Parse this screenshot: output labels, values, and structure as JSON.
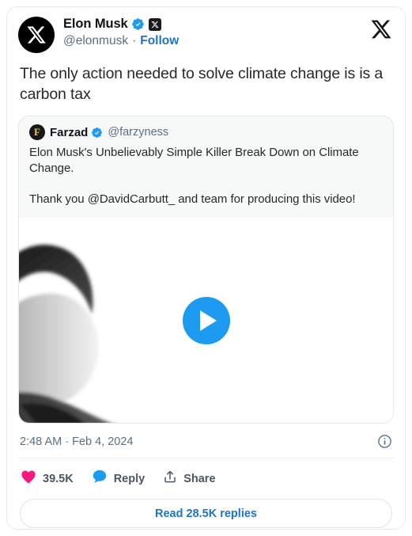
{
  "author": {
    "display_name": "Elon Musk",
    "handle": "@elonmusk",
    "separator": "·",
    "follow_label": "Follow",
    "avatar_icon": "x-logo-avatar",
    "verified_icon": "verified-badge-icon",
    "x_badge_icon": "x-square-badge-icon"
  },
  "brand": {
    "logo_icon": "x-logo"
  },
  "tweet": {
    "text": "The only action needed to solve climate change is is a carbon tax"
  },
  "quoted": {
    "avatar_letter": "F",
    "display_name": "Farzad",
    "verified_icon": "verified-badge-icon",
    "handle": "@farzyness",
    "line1": "Elon Musk's Unbelievably Simple Killer Break Down on Climate Change.",
    "line2": "Thank you @DavidCarbutt_ and team for producing this video!",
    "media": {
      "type": "video",
      "play_icon": "play-button-icon"
    }
  },
  "meta": {
    "timestamp": "2:48 AM · Feb 4, 2024",
    "info_icon": "info-circle-icon"
  },
  "actions": {
    "like": {
      "icon": "heart-icon",
      "count": "39.5K"
    },
    "reply": {
      "icon": "reply-bubble-icon",
      "label": "Reply"
    },
    "share": {
      "icon": "share-upload-icon",
      "label": "Share"
    }
  },
  "footer": {
    "read_replies_label": "Read 28.5K replies"
  },
  "colors": {
    "accent_blue": "#1d9bf0",
    "link_blue": "#1d74c8",
    "like_pink": "#f91880",
    "text_primary": "#0f1419",
    "text_secondary": "#5b7083",
    "quote_bg": "#f7f9f9"
  }
}
